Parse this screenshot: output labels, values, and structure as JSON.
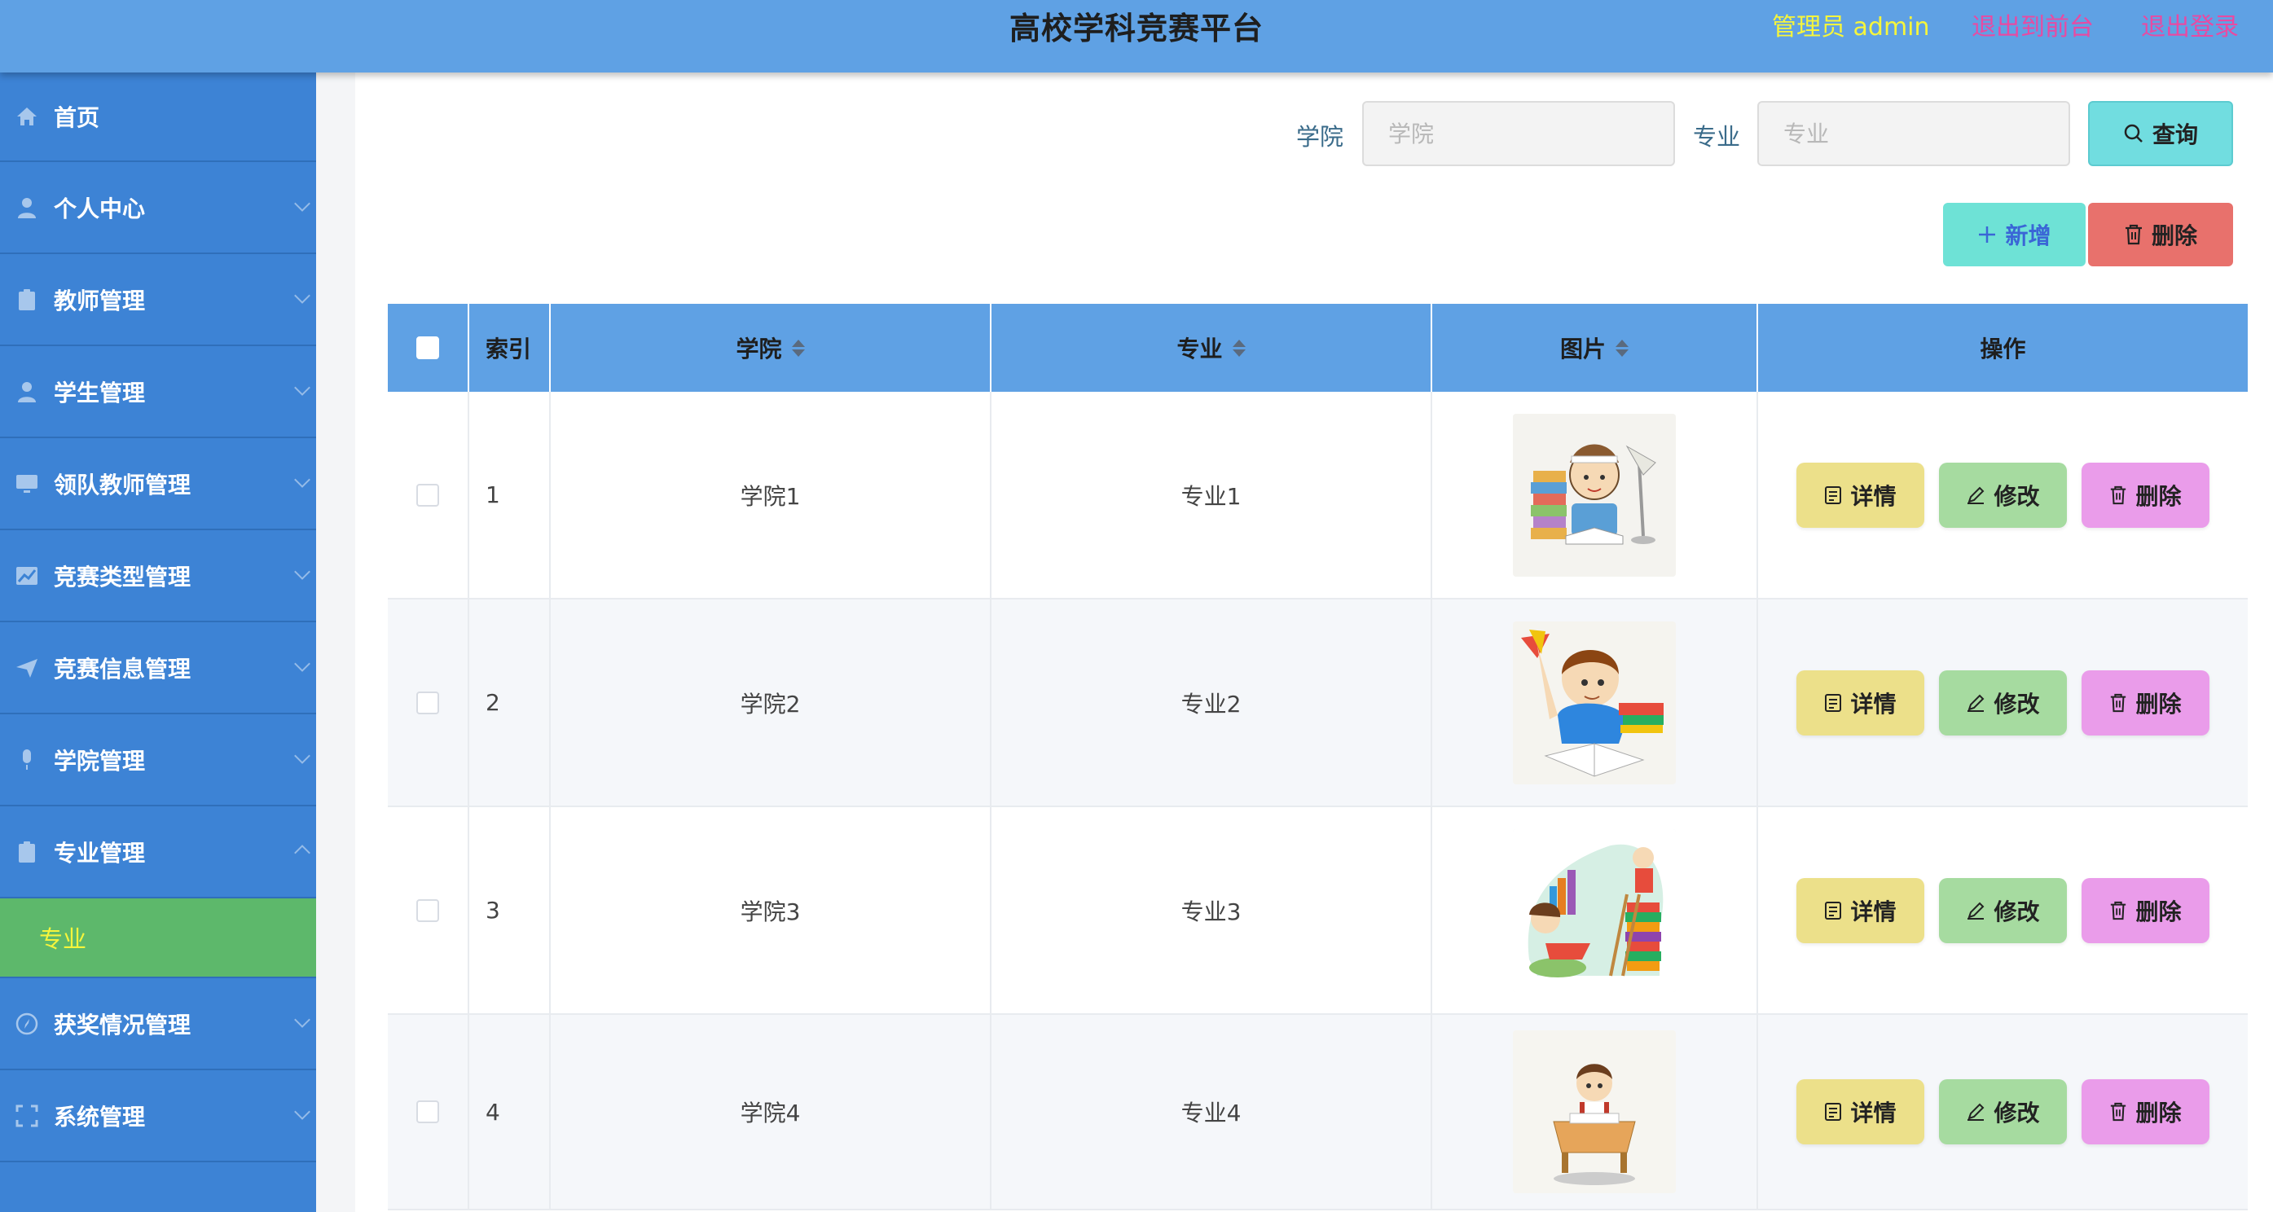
{
  "header": {
    "title": "高校学科竞赛平台",
    "user": "管理员 admin",
    "back_to_front": "退出到前台",
    "logout": "退出登录"
  },
  "sidebar": {
    "items": [
      {
        "label": "首页",
        "icon": "home-icon"
      },
      {
        "label": "个人中心",
        "icon": "user-icon"
      },
      {
        "label": "教师管理",
        "icon": "clipboard-icon"
      },
      {
        "label": "学生管理",
        "icon": "user-icon"
      },
      {
        "label": "领队教师管理",
        "icon": "monitor-icon"
      },
      {
        "label": "竞赛类型管理",
        "icon": "chart-icon"
      },
      {
        "label": "竞赛信息管理",
        "icon": "send-icon"
      },
      {
        "label": "学院管理",
        "icon": "microphone-icon"
      },
      {
        "label": "专业管理",
        "icon": "clipboard-icon"
      },
      {
        "label": "获奖情况管理",
        "icon": "compass-icon"
      },
      {
        "label": "系统管理",
        "icon": "frame-icon"
      }
    ],
    "active_sub": "专业"
  },
  "search": {
    "college_label": "学院",
    "college_placeholder": "学院",
    "major_label": "专业",
    "major_placeholder": "专业",
    "query_button": "查询"
  },
  "toolbar": {
    "add_button": "新增",
    "delete_button": "删除"
  },
  "table": {
    "columns": [
      "索引",
      "学院",
      "专业",
      "图片",
      "操作"
    ],
    "rows": [
      {
        "index": "1",
        "college": "学院1",
        "major": "专业1"
      },
      {
        "index": "2",
        "college": "学院2",
        "major": "专业2"
      },
      {
        "index": "3",
        "college": "学院3",
        "major": "专业3"
      },
      {
        "index": "4",
        "college": "学院4",
        "major": "专业4"
      }
    ],
    "actions": {
      "detail": "详情",
      "edit": "修改",
      "delete": "删除"
    }
  }
}
